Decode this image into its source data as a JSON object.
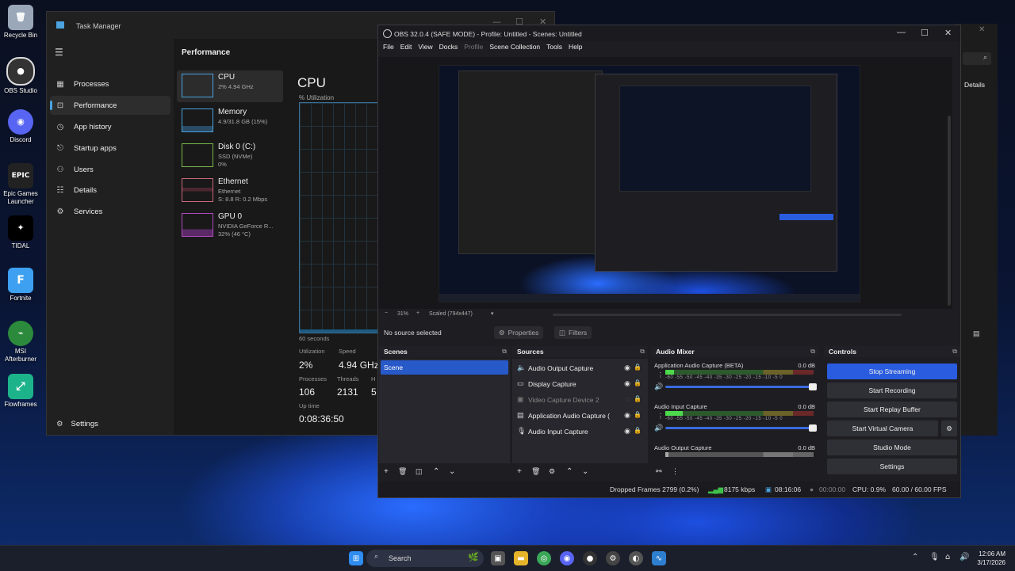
{
  "desktop": {
    "icons": [
      {
        "label": "Recycle Bin",
        "icon": "recycle-bin-icon",
        "color": "#9aa7b8"
      },
      {
        "label": "OBS Studio",
        "icon": "obs-icon",
        "color": "#333333"
      },
      {
        "label": "Discord",
        "icon": "discord-icon",
        "color": "#5865f2"
      },
      {
        "label": "Epic Games Launcher",
        "icon": "epic-games-icon",
        "color": "#222222"
      },
      {
        "label": "TIDAL",
        "icon": "tidal-icon",
        "color": "#000000"
      },
      {
        "label": "Fortnite",
        "icon": "fortnite-icon",
        "color": "#3ea0f0"
      },
      {
        "label": "MSI Afterburner",
        "icon": "msi-afterburner-icon",
        "color": "#2c8a3c"
      },
      {
        "label": "Flowframes",
        "icon": "flowframes-icon",
        "color": "#1db38a"
      }
    ]
  },
  "task_manager": {
    "title": "Task Manager",
    "nav": [
      {
        "label": "Processes",
        "icon": "processes-icon"
      },
      {
        "label": "Performance",
        "icon": "performance-icon",
        "selected": true
      },
      {
        "label": "App history",
        "icon": "app-history-icon"
      },
      {
        "label": "Startup apps",
        "icon": "startup-apps-icon"
      },
      {
        "label": "Users",
        "icon": "users-icon"
      },
      {
        "label": "Details",
        "icon": "details-icon"
      },
      {
        "label": "Services",
        "icon": "services-icon"
      }
    ],
    "settings_label": "Settings",
    "section_title": "Performance",
    "perf_items": [
      {
        "name": "CPU",
        "line1": "2% 4.94 GHz",
        "line2": "",
        "color": "#4ba3e0"
      },
      {
        "name": "Memory",
        "line1": "4.9/31.8 GB (15%)",
        "line2": "",
        "color": "#4ba3e0"
      },
      {
        "name": "Disk 0 (C:)",
        "line1": "SSD (NVMe)",
        "line2": "0%",
        "color": "#78b84a"
      },
      {
        "name": "Ethernet",
        "line1": "Ethernet",
        "line2": "S: 8.8 R: 0.2 Mbps",
        "color": "#c8697a"
      },
      {
        "name": "GPU 0",
        "line1": "NVIDIA GeForce R...",
        "line2": "32% (46 °C)",
        "color": "#b14ac0"
      }
    ],
    "cpu_title": "CPU",
    "cpu_util_label": "% Utilization",
    "graph_label": "60 seconds",
    "stats": {
      "utilization_label": "Utilization",
      "utilization": "2%",
      "speed_label": "Speed",
      "speed": "4.94 GHz",
      "processes_label": "Processes",
      "processes": "106",
      "threads_label": "Threads",
      "threads": "2131",
      "handles_label": "H",
      "handles": "5",
      "uptime_label": "Up time",
      "uptime": "0:08:36:50"
    }
  },
  "obs": {
    "title": "OBS 32.0.4 (SAFE MODE) - Profile: Untitled - Scenes: Untitled",
    "menu": [
      "File",
      "Edit",
      "View",
      "Docks",
      "Profile",
      "Scene Collection",
      "Tools",
      "Help"
    ],
    "zoom": "31%",
    "scale_label": "Scaled (794x447)",
    "no_source": "No source selected",
    "properties_label": "Properties",
    "filters_label": "Filters",
    "scenes_header": "Scenes",
    "scenes": [
      "Scene"
    ],
    "sources_header": "Sources",
    "sources": [
      {
        "name": "Audio Output Capture",
        "icon": "speaker-icon",
        "hidden": false
      },
      {
        "name": "Display Capture",
        "icon": "monitor-icon",
        "hidden": false
      },
      {
        "name": "Video Capture Device 2",
        "icon": "camera-icon",
        "hidden": true
      },
      {
        "name": "Application Audio Capture (",
        "icon": "app-audio-icon",
        "hidden": false
      },
      {
        "name": "Audio Input Capture",
        "icon": "microphone-icon",
        "hidden": false
      }
    ],
    "mixer_header": "Audio Mixer",
    "mixer": [
      {
        "name": "Application Audio Capture (BETA)",
        "db": "0.0 dB",
        "level": 0.06
      },
      {
        "name": "Audio Input Capture",
        "db": "0.0 dB",
        "level": 0.12
      },
      {
        "name": "Audio Output Capture",
        "db": "0.0 dB",
        "level": 0.02
      }
    ],
    "mixer_ticks": "-60 -55 -50 -45 -40 -35 -30 -25 -20 -15 -10 -5 0",
    "controls_header": "Controls",
    "controls": [
      "Stop Streaming",
      "Start Recording",
      "Start Replay Buffer",
      "Start Virtual Camera",
      "Studio Mode",
      "Settings"
    ],
    "status": {
      "dropped": "Dropped Frames 2799 (0.2%)",
      "bitrate": "8175 kbps",
      "stream_time": "08:16:06",
      "rec_time": "00:00:00",
      "cpu": "CPU: 0.9%",
      "fps": "60.00 / 60.00 FPS"
    },
    "accent": "#2a5ce0"
  },
  "bg_window": {
    "details_label": "Details"
  },
  "taskbar": {
    "search_label": "Search",
    "time": "12:06 AM",
    "date": "3/17/2026"
  }
}
